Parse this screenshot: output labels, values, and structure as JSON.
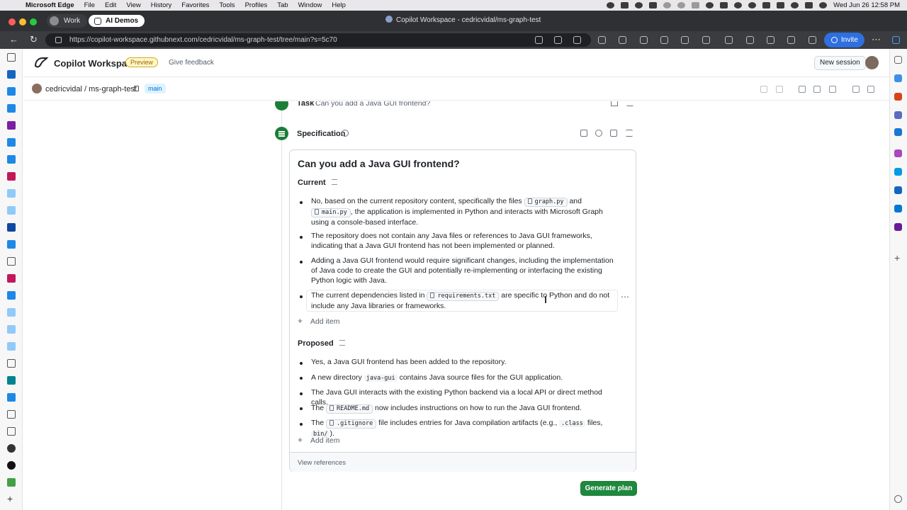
{
  "menubar": {
    "app": "Microsoft Edge",
    "items": [
      "File",
      "Edit",
      "View",
      "History",
      "Favorites",
      "Tools",
      "Profiles",
      "Tab",
      "Window",
      "Help"
    ],
    "clock": "Wed Jun 26  12:58 PM"
  },
  "browser": {
    "profile": "Work",
    "active_tab": "AI Demos",
    "window_title": "Copilot Workspace - cedricvidal/ms-graph-test",
    "url": "https://copilot-workspace.githubnext.com/cedricvidal/ms-graph-test/tree/main?s=5c70",
    "invite": "Invite"
  },
  "app": {
    "title": "Copilot Workspace",
    "badge": "Preview",
    "feedback": "Give feedback",
    "new_session": "New session",
    "accent": "#1f883d"
  },
  "repo": {
    "owner_repo": "cedricvidal / ms-graph-test",
    "branch": "main"
  },
  "task": {
    "label": "Task",
    "text": "Can you add a Java GUI frontend?"
  },
  "spec": {
    "label": "Specification",
    "title": "Can you add a Java GUI frontend?",
    "current_heading": "Current",
    "current": [
      {
        "a": "No, based on the current repository content, specifically the files",
        "chip1": "graph.py",
        "mid": "and",
        "chip2": "main.py",
        "b": ", the application is implemented in Python and interacts with Microsoft Graph using a console-based interface."
      },
      {
        "text": "The repository does not contain any Java files or references to Java GUI frameworks, indicating that a Java GUI frontend has not been implemented or planned."
      },
      {
        "text": "Adding a Java GUI frontend would require significant changes, including the implementation of Java code to create the GUI and potentially re-implementing or interfacing the existing Python logic with Java."
      },
      {
        "a": "The current dependencies listed in",
        "chip": "requirements.txt",
        "b": "are specific to Python and do not include any Java libraries or frameworks."
      }
    ],
    "add_item": "Add item",
    "proposed_heading": "Proposed",
    "proposed": [
      {
        "text": "Yes, a Java GUI frontend has been added to the repository."
      },
      {
        "a": "A new directory",
        "code": "java-gui",
        "b": "contains Java source files for the GUI application."
      },
      {
        "text": "The Java GUI interacts with the existing Python backend via a local API or direct method calls."
      },
      {
        "a": "The",
        "chip": "README.md",
        "b": "now includes instructions on how to run the Java GUI frontend."
      },
      {
        "a": "The",
        "chip": ".gitignore",
        "b": "file includes entries for Java compilation artifacts (e.g.,",
        "code1": ".class",
        "c": "files,",
        "code2": "bin/",
        "d": ")."
      }
    ],
    "view_references": "View references",
    "generate_plan": "Generate plan"
  }
}
